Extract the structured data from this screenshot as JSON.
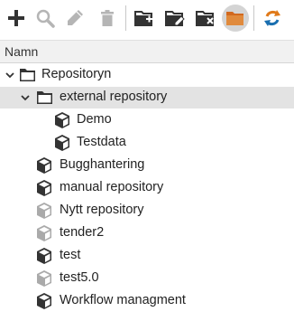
{
  "toolbar": {
    "buttons": [
      {
        "name": "add-icon",
        "color": "#333333"
      },
      {
        "name": "search-icon",
        "color": "#b5b5b5"
      },
      {
        "name": "edit-icon",
        "color": "#b5b5b5"
      },
      {
        "name": "delete-icon",
        "color": "#b5b5b5"
      },
      {
        "name": "new-folder-icon",
        "color": "#333333"
      },
      {
        "name": "edit-folder-icon",
        "color": "#333333"
      },
      {
        "name": "delete-folder-icon",
        "color": "#333333"
      },
      {
        "name": "folder-icon",
        "color": "#d2691e"
      },
      {
        "name": "refresh-icon",
        "color": "#e07a1a"
      }
    ]
  },
  "header": {
    "column_label": "Namn"
  },
  "tree": {
    "root": {
      "label": "Repositoryn",
      "expanded": true
    },
    "folder": {
      "label": "external repository",
      "expanded": true,
      "selected": true
    },
    "folder_children": [
      "Demo",
      "Testdata"
    ],
    "items": [
      {
        "label": "Bugghantering",
        "enabled": true
      },
      {
        "label": "manual repository",
        "enabled": true
      },
      {
        "label": "Nytt repository",
        "enabled": false
      },
      {
        "label": "tender2",
        "enabled": false
      },
      {
        "label": "test",
        "enabled": true
      },
      {
        "label": "test5.0",
        "enabled": false
      },
      {
        "label": "Workflow managment",
        "enabled": true
      }
    ]
  }
}
